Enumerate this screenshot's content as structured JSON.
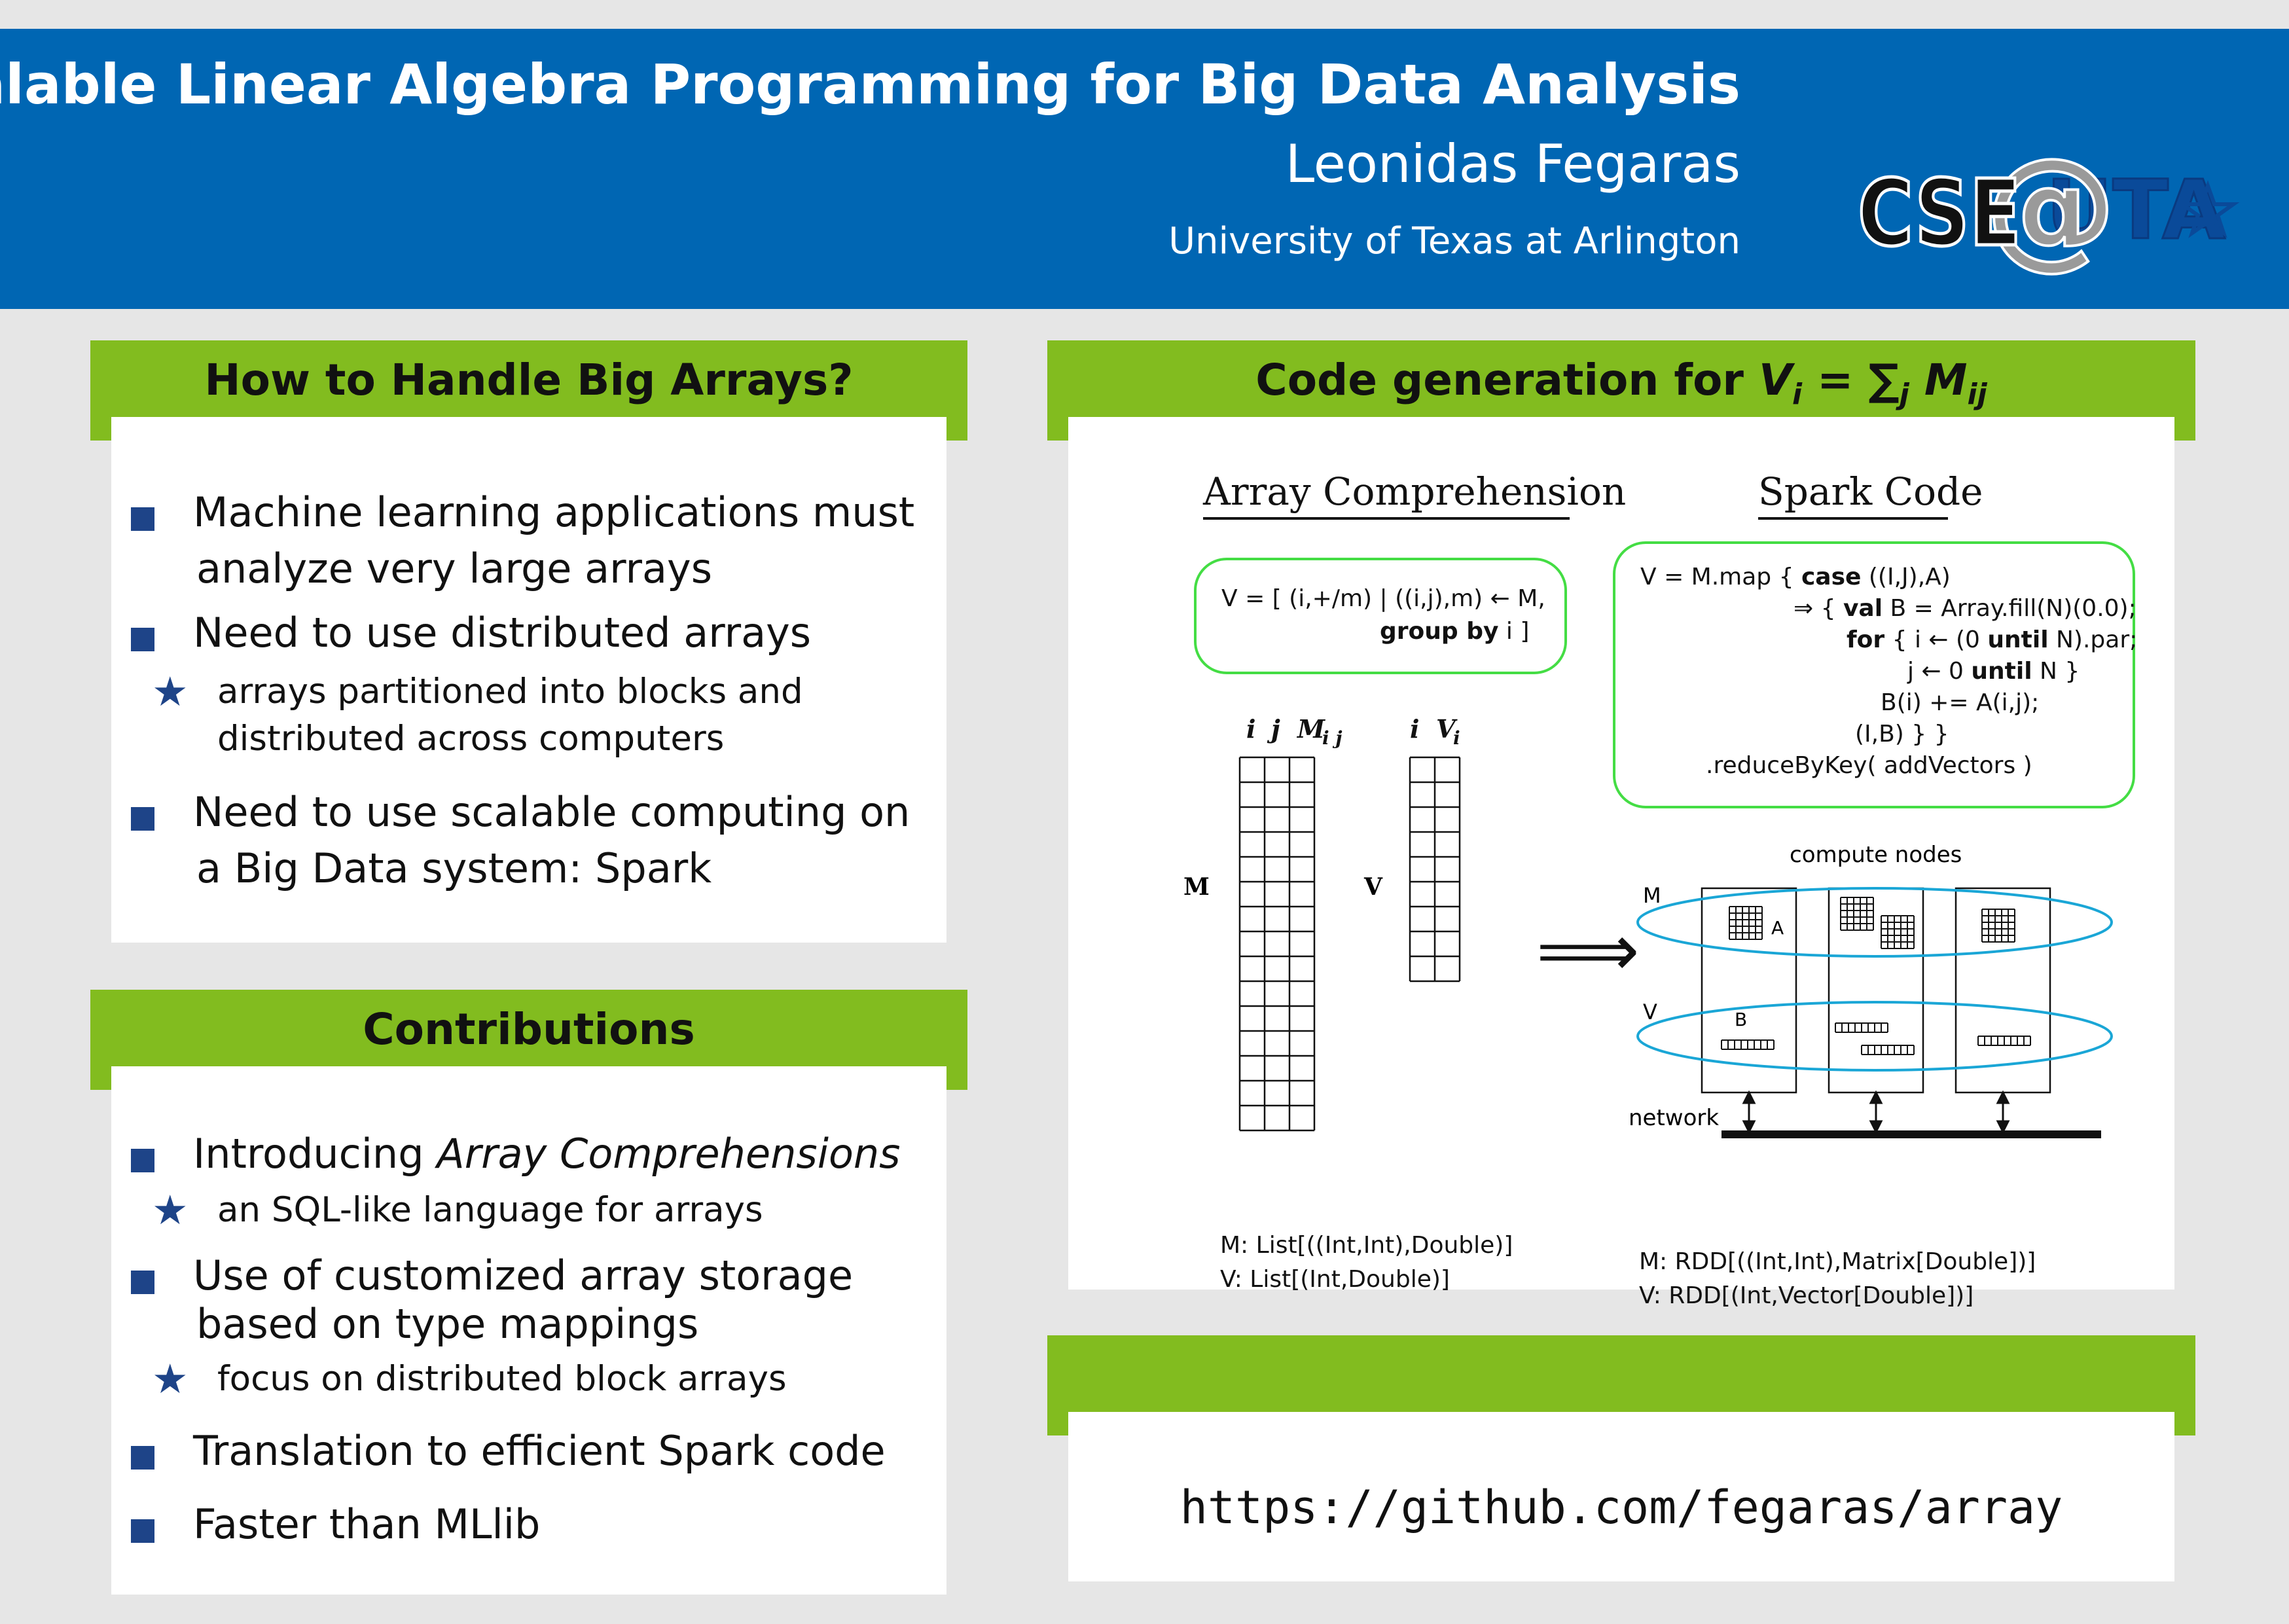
{
  "header": {
    "title": "Scalable Linear Algebra Programming for Big Data Analysis",
    "author": "Leonidas Fegaras",
    "affiliation": "University of Texas at Arlington",
    "logo": {
      "cse": "CSE",
      "at": "@",
      "uta": "UTA",
      "colors": {
        "cse": "#111111",
        "at": "#9a9a9a",
        "uta": "#0a4a99"
      }
    }
  },
  "colors": {
    "header_bg": "#0066b3",
    "panel_header": "#82bc1f",
    "bullet": "#1e4488",
    "code_border": "#44dd44",
    "ellipse": "#1aa6d6"
  },
  "panel1": {
    "title": "How to Handle Big Arrays?",
    "items": [
      {
        "l1": "Machine learning applications must",
        "l2": "analyze very large arrays"
      },
      {
        "l1": "Need to use distributed arrays"
      },
      {
        "l1": "arrays partitioned into blocks and",
        "l2": "distributed across computers"
      },
      {
        "l1": "Need to use scalable computing on",
        "l2": "a Big Data system: Spark"
      }
    ]
  },
  "panel2": {
    "title": "Contributions",
    "item1_prefix": "Introducing ",
    "item1_em": "Array Comprehensions",
    "item2": "an SQL-like language for arrays",
    "item3_l1": "Use of customized array storage",
    "item3_l2": "based on type mappings",
    "item4": "focus on distributed block arrays",
    "item5": "Translation to efficient Spark code",
    "item6": "Faster than MLlib"
  },
  "panel3": {
    "title_prefix": "Code generation for ",
    "eq": {
      "lhs": "V",
      "lhs_sub": "i",
      "op": " = ∑",
      "sum_sub": "j",
      "rhs": " M",
      "rhs_sub": "ij"
    },
    "left_heading": "Array Comprehension",
    "right_heading": "Spark Code",
    "comp_line1": "V = [ (i,+/m) | ((i,j),m) ← M,",
    "comp_kw": "group by",
    "comp_line2_rest": " i ]",
    "spark": {
      "l1_a": "V = M.map { ",
      "l1_kw": "case",
      "l1_b": " ((I,J),A)",
      "l2_a": "⇒ { ",
      "l2_kw": "val",
      "l2_b": " B = Array.fill(N)(0.0);",
      "l3_kw": "for",
      "l3_a": " { i ← (0 ",
      "l3_kw2": "until",
      "l3_b": " N).par;",
      "l4_a": "j ← 0 ",
      "l4_kw": "until",
      "l4_b": " N }",
      "l5": "B(i) += A(i,j);",
      "l6": "(I,B) } }",
      "l7": ".reduceByKey( addVectors )"
    },
    "diagram": {
      "m_cols": [
        "i",
        "j",
        "M"
      ],
      "m_sub": "i j",
      "v_cols": [
        "i",
        "V"
      ],
      "v_sub": "i",
      "m_label": "M",
      "v_label": "V",
      "m_type": "M: List[((Int,Int),Double)]",
      "v_type": "V: List[(Int,Double)]",
      "implies": "⟹",
      "compute_nodes": "compute nodes",
      "row_m": "M",
      "row_v": "V",
      "block_a": "A",
      "block_b": "B",
      "network": "network",
      "rdd_m": "M: RDD[((Int,Int),Matrix[Double])]",
      "rdd_v": "V: RDD[(Int,Vector[Double])]"
    }
  },
  "panel4": {
    "url": "https://github.com/fegaras/array"
  }
}
